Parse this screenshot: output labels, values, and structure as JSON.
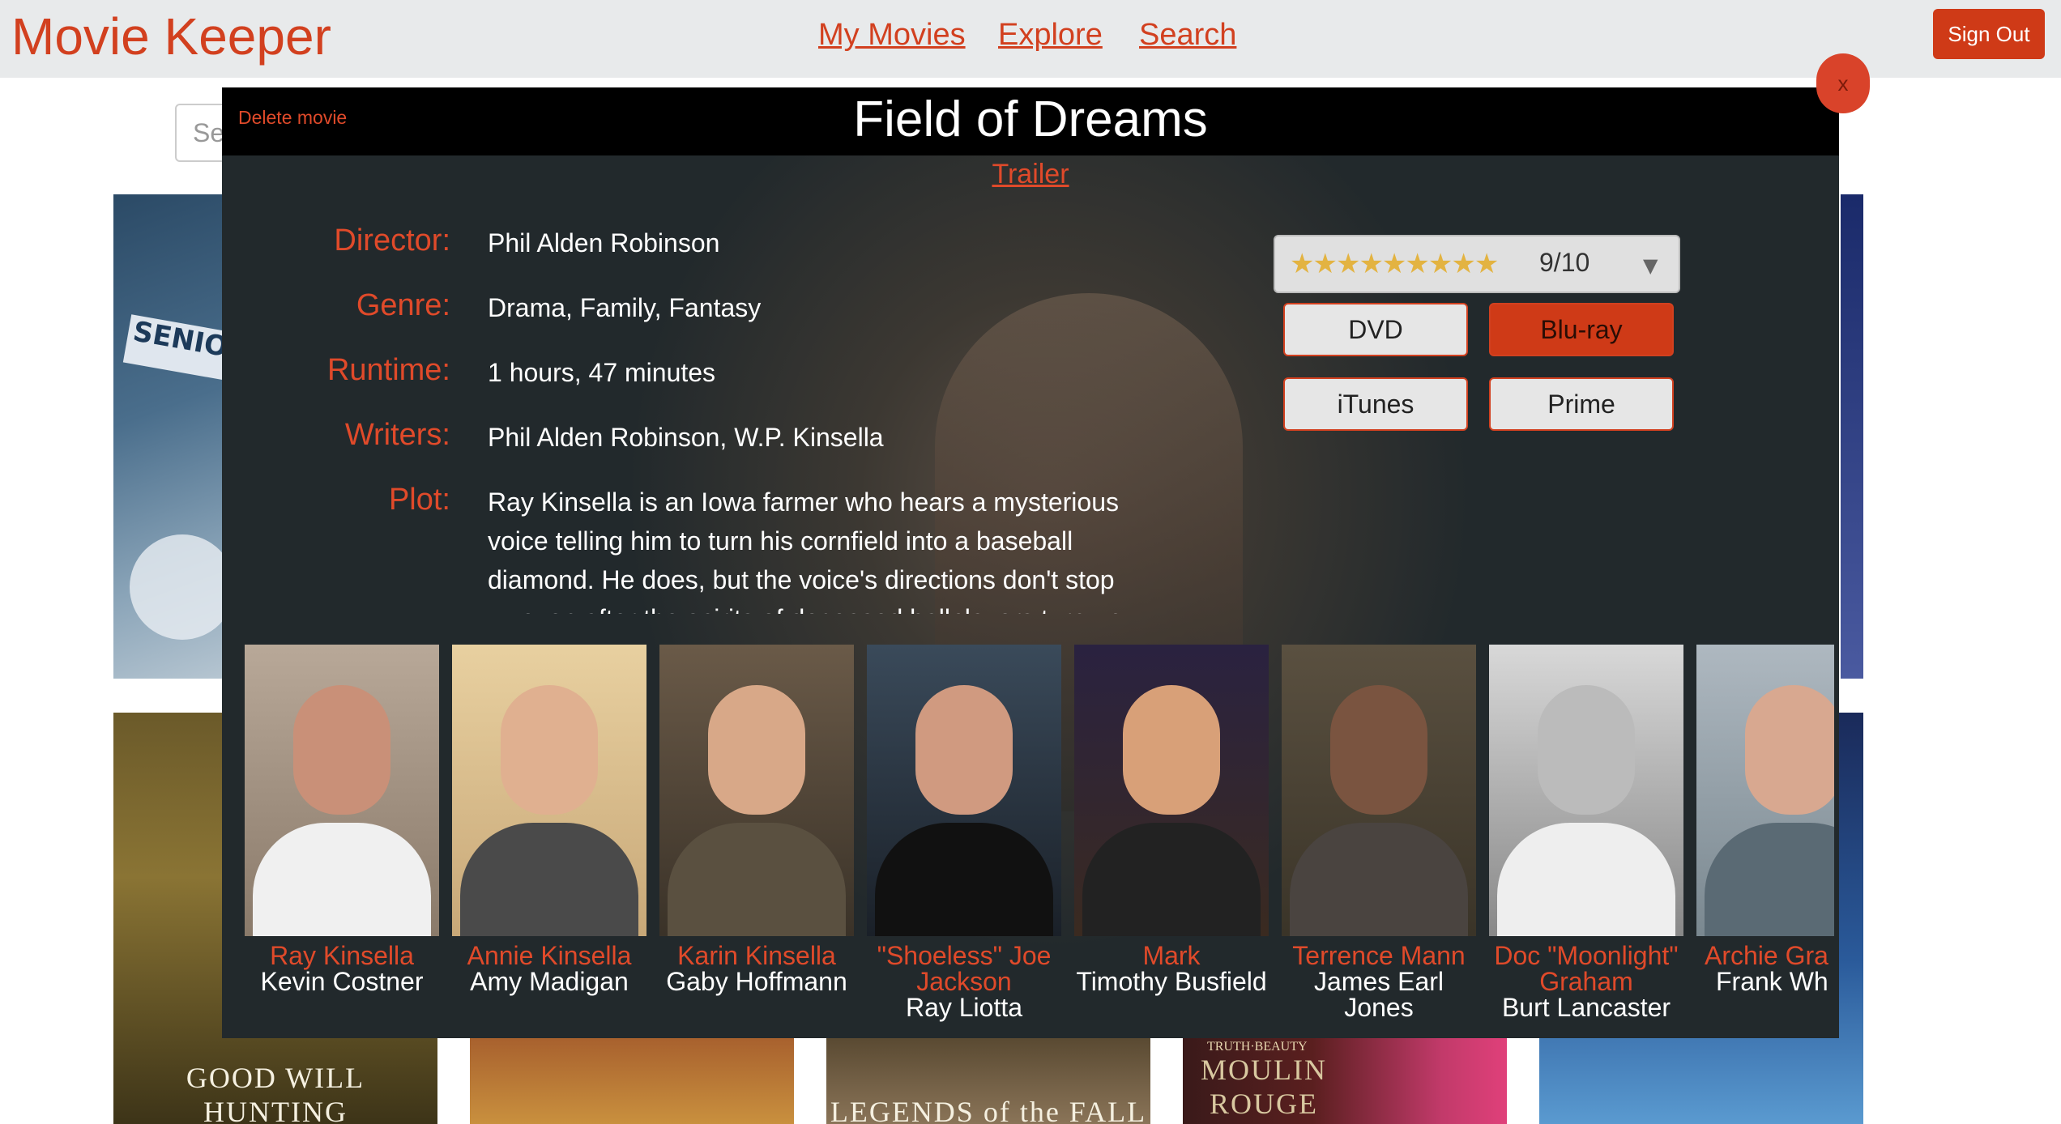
{
  "navbar": {
    "brand": "Movie Keeper",
    "links": [
      "My Movies",
      "Explore",
      "Search"
    ],
    "sign_out": "Sign Out"
  },
  "background": {
    "search_placeholder": "Se",
    "poster_titles": [
      "GOOD WILL HUNTING",
      "LEGENDS of the FALL",
      "MOULIN ROUGE"
    ],
    "poster_banner": "SENIOR",
    "poster_sub": "TRUTH·BEAUTY"
  },
  "modal": {
    "delete_label": "Delete movie",
    "title": "Field of Dreams",
    "trailer_label": "Trailer",
    "close_label": "x",
    "labels": {
      "director": "Director:",
      "genre": "Genre:",
      "runtime": "Runtime:",
      "writers": "Writers:",
      "plot": "Plot:"
    },
    "values": {
      "director": "Phil Alden Robinson",
      "genre": "Drama, Family, Fantasy",
      "runtime": "1 hours, 47 minutes",
      "writers": "Phil Alden Robinson, W.P. Kinsella",
      "plot": "Ray Kinsella is an Iowa farmer who hears a mysterious voice telling him to turn his cornfield into a baseball diamond. He does, but the voice's directions don't stop — even after the spirits of deceased ballplayers turn up to play."
    },
    "rating": {
      "stars": "★★★★★★★★★",
      "value": "9/10",
      "score": 9,
      "max": 10
    },
    "formats": [
      {
        "label": "DVD",
        "active": false
      },
      {
        "label": "Blu-ray",
        "active": true
      },
      {
        "label": "iTunes",
        "active": false
      },
      {
        "label": "Prime",
        "active": false
      }
    ],
    "cast": [
      {
        "character": "Ray Kinsella",
        "actor": "Kevin Costner"
      },
      {
        "character": "Annie Kinsella",
        "actor": "Amy Madigan"
      },
      {
        "character": "Karin Kinsella",
        "actor": "Gaby Hoffmann"
      },
      {
        "character": "\"Shoeless\" Joe Jackson",
        "actor": "Ray Liotta"
      },
      {
        "character": "Mark",
        "actor": "Timothy Busfield"
      },
      {
        "character": "Terrence Mann",
        "actor": "James Earl Jones"
      },
      {
        "character": "Doc \"Moonlight\" Graham",
        "actor": "Burt Lancaster"
      },
      {
        "character": "Archie Gra",
        "actor": "Frank Wh"
      }
    ]
  },
  "colors": {
    "accent": "#d2401f",
    "navbar_bg": "#e8eaeb",
    "modal_bg": "#1d2428"
  }
}
